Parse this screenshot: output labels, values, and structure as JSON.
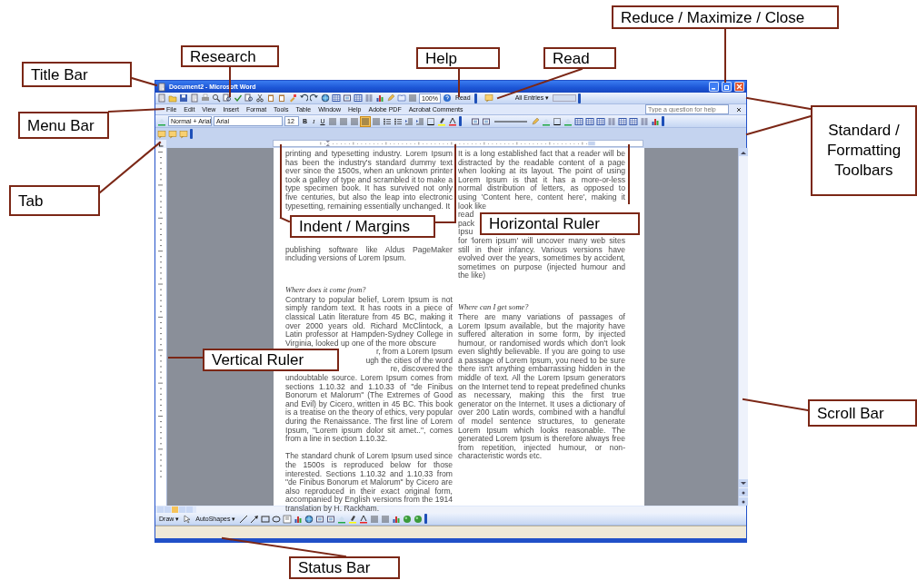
{
  "window": {
    "title": "Document2 - Microsoft Word"
  },
  "standard_toolbar": {
    "zoom": "100%",
    "read_button": "Read",
    "show_dropdown": "All Entries ▾"
  },
  "menu_bar": {
    "items": [
      "File",
      "Edit",
      "View",
      "Insert",
      "Format",
      "Tools",
      "Table",
      "Window",
      "Help",
      "Adobe PDF",
      "Acrobat Comments"
    ]
  },
  "help_box": {
    "placeholder": "Type a question for help"
  },
  "formatting_toolbar": {
    "style": "Normal + Arial",
    "font": "Arial",
    "size": "12",
    "buttons": [
      "B",
      "I",
      "U"
    ],
    "alignments": [
      {
        "selected": false
      },
      {
        "selected": false
      },
      {
        "selected": false
      },
      {
        "selected": true
      }
    ]
  },
  "document": {
    "left_column": [
      {
        "kind": "paragraph",
        "text": "printing and typesetting industry. Lorem Ipsum has been the industry's standard dummy text ever since the 1500s, when an unknown printer took a galley of type and scrambled it to make a type specimen book. It has survived not only five centuries, but also the leap into electronic typesetting, remaining essentially unchanged. It"
      },
      {
        "kind": "covered",
        "label": "Indent / Margins"
      },
      {
        "kind": "paragraph",
        "text": "publishing software like Aldus PageMaker including versions of Lorem Ipsum."
      },
      {
        "kind": "heading",
        "text": "Where does it come from?"
      },
      {
        "kind": "paragraph",
        "text": "Contrary to popular belief, Lorem Ipsum is not simply random text. It has roots in a piece of classical Latin literature from 45 BC, making it over 2000 years old. Richard McClintock, a Latin professor at Hampden-Sydney College in Virginia, looked up one of the more obscure"
      },
      {
        "kind": "covered",
        "label": "Vertical Ruler",
        "fragments": [
          "r, from a Lorem Ipsum",
          "ugh the cities of the word",
          "re, discovered the"
        ]
      },
      {
        "kind": "paragraph",
        "text": "undoubtable source. Lorem Ipsum comes from sections 1.10.32 and 1.10.33 of \"de Finibus Bonorum et Malorum\" (The Extremes of Good and Evil) by Cicero, written in 45 BC. This book is a treatise on the theory of ethics, very popular during the Renaissance. The first line of Lorem Ipsum, \"Lorem ipsum dolor sit amet..\", comes from a line in section 1.10.32."
      },
      {
        "kind": "paragraph",
        "text": "The standard chunk of Lorem Ipsum used since the 1500s is reproduced below for those interested. Sections 1.10.32 and 1.10.33 from \"de Finibus Bonorum et Malorum\" by Cicero are also reproduced in their exact original form, accompanied by English versions from the 1914 translation by H. Rackham."
      }
    ],
    "right_column": [
      {
        "kind": "paragraph",
        "text": "It is a long established fact that a reader will be distracted by the readable content of a page when looking at its layout. The point of using Lorem Ipsum is that it has a more-or-less normal distribution of letters, as opposed to using 'Content here, content here', making it look like"
      },
      {
        "kind": "covered",
        "label": "Horizontal Ruler",
        "fragments": [
          "read",
          "pack",
          "Ipsu"
        ]
      },
      {
        "kind": "paragraph",
        "text": "for 'lorem ipsum' will uncover many web sites still in their infancy. Various versions have evolved over the years, sometimes by accident, sometimes on purpose (injected humour and the like)"
      },
      {
        "kind": "heading",
        "text": "Where can I get some?"
      },
      {
        "kind": "paragraph",
        "text": "There are many variations of passages of Lorem Ipsum available, but the majority have suffered alteration in some form, by injected humour, or randomised words which don't look even slightly believable. If you are going to use a passage of Lorem Ipsum, you need to be sure there isn't anything embarrassing hidden in the middle of text. All the Lorem Ipsum generators on the Internet tend to repeat predefined chunks as necessary, making this the first true generator on the Internet. It uses a dictionary of over 200 Latin words, combined with a handful of model sentence structures, to generate Lorem Ipsum which looks reasonable. The generated Lorem Ipsum is therefore always free from repetition, injected humour, or non-characteristic words etc."
      }
    ]
  },
  "drawing_toolbar": {
    "draw": "Draw ▾",
    "autoshapes": "AutoShapes ▾"
  },
  "callouts": [
    {
      "text": "Title Bar"
    },
    {
      "text": "Research"
    },
    {
      "text": "Help"
    },
    {
      "text": "Read"
    },
    {
      "text": "Reduce / Maximize / Close"
    },
    {
      "text": "Menu Bar"
    },
    {
      "text": "Standard / Formatting Toolbars"
    },
    {
      "text": "Tab"
    },
    {
      "text": "Scroll Bar"
    },
    {
      "text": "Status Bar"
    }
  ]
}
